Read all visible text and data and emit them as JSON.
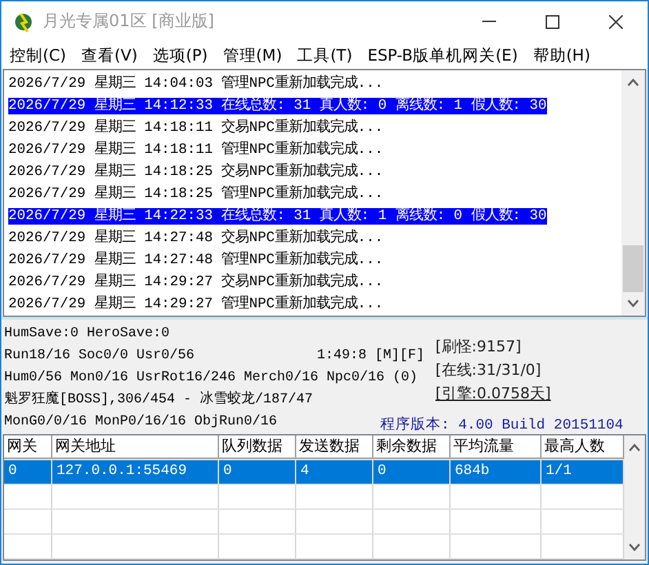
{
  "window": {
    "title": "月光专属01区 [商业版]"
  },
  "menu": [
    "控制(C)",
    "查看(V)",
    "选项(P)",
    "管理(M)",
    "工具(T)",
    "ESP-B版单机网关(E)",
    "帮助(H)"
  ],
  "log": [
    {
      "text": "2026/7/29 星期三 14:04:03 管理NPC重新加载完成...",
      "selected": false
    },
    {
      "text": "2026/7/29 星期三 14:12:33 在线总数: 31 真人数: 0 离线数: 1 假人数: 30",
      "selected": true
    },
    {
      "text": "2026/7/29 星期三 14:18:11 交易NPC重新加载完成...",
      "selected": false
    },
    {
      "text": "2026/7/29 星期三 14:18:11 管理NPC重新加载完成...",
      "selected": false
    },
    {
      "text": "2026/7/29 星期三 14:18:25 交易NPC重新加载完成...",
      "selected": false
    },
    {
      "text": "2026/7/29 星期三 14:18:25 管理NPC重新加载完成...",
      "selected": false
    },
    {
      "text": "2026/7/29 星期三 14:22:33 在线总数: 31 真人数: 1 离线数: 0 假人数: 30",
      "selected": true
    },
    {
      "text": "2026/7/29 星期三 14:27:48 交易NPC重新加载完成...",
      "selected": false
    },
    {
      "text": "2026/7/29 星期三 14:27:48 管理NPC重新加载完成...",
      "selected": false
    },
    {
      "text": "2026/7/29 星期三 14:29:27 交易NPC重新加载完成...",
      "selected": false
    },
    {
      "text": "2026/7/29 星期三 14:29:27 管理NPC重新加载完成...",
      "selected": false
    }
  ],
  "status": {
    "lines": [
      "HumSave:0 HeroSave:0",
      "Run18/16 Soc0/0 Usr0/56",
      "Hum0/56 Mon0/16 UsrRot16/246 Merch0/16 Npc0/16 (0)",
      "魁罗狂魔[BOSS],306/454 - 冰雪蛟龙/187/47",
      "MonG0/0/16 MonP0/16/16 ObjRun0/16"
    ],
    "timer": "1:49:8 [M][F]",
    "refresh": "[刷怪:9157]",
    "online": "[在线:31/31/0]",
    "engine": "[引擎:0.0758天]",
    "version": "程序版本: 4.00 Build 20151104"
  },
  "table": {
    "columns": [
      "网关",
      "网关地址",
      "队列数据",
      "发送数据",
      "剩余数据",
      "平均流量",
      "最高人数"
    ],
    "rows": [
      {
        "cells": [
          "0",
          "127.0.0.1:55469",
          "0",
          "4",
          "0",
          "684b",
          "1/1"
        ],
        "selected": true
      }
    ]
  }
}
